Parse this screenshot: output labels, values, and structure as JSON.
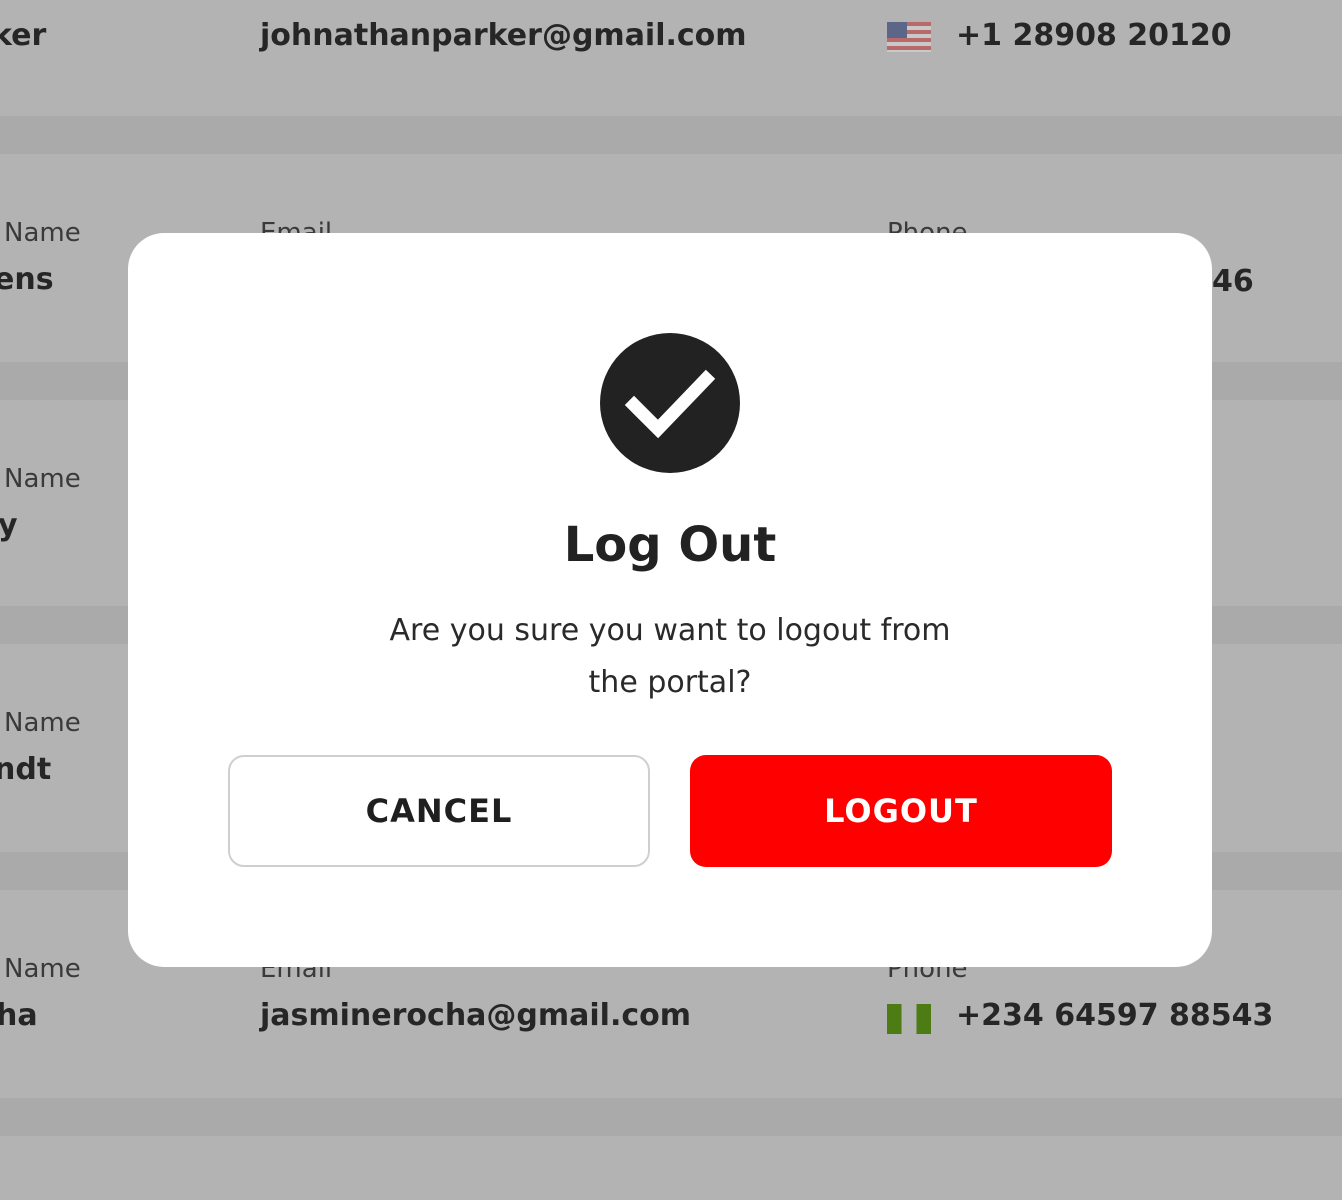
{
  "background_list": {
    "rows": [
      {
        "name_label": "",
        "name_value": "ker",
        "email_label": "",
        "email_value": "johnathanparker@gmail.com",
        "phone_label": "",
        "phone_value": "+1 28908 20120",
        "flag": "us-flag-icon"
      },
      {
        "name_label": "Name",
        "name_value": "ens",
        "email_label": "Email",
        "email_value": "",
        "phone_label": "Phone",
        "phone_value": "46",
        "flag": ""
      },
      {
        "name_label": "Name",
        "name_value": "y",
        "email_label": "",
        "email_value": "",
        "phone_label": "",
        "phone_value": "",
        "flag": ""
      },
      {
        "name_label": "Name",
        "name_value": "ndt",
        "email_label": "",
        "email_value": "",
        "phone_label": "",
        "phone_value": "",
        "flag": ""
      },
      {
        "name_label": "Name",
        "name_value": "ha",
        "email_label": "Email",
        "email_value": "jasminerocha@gmail.com",
        "phone_label": "Phone",
        "phone_value": "+234 64597 88543",
        "flag": "ng-flag-icon"
      }
    ]
  },
  "modal": {
    "icon": "check-circle-icon",
    "title": "Log Out",
    "message": "Are you sure you want to logout from the portal?",
    "cancel_label": "CANCEL",
    "logout_label": "LOGOUT"
  },
  "colors": {
    "overlay": "#b3b3b3",
    "modal_bg": "#ffffff",
    "logout_button": "#ff0000",
    "icon_circle": "#222222"
  }
}
